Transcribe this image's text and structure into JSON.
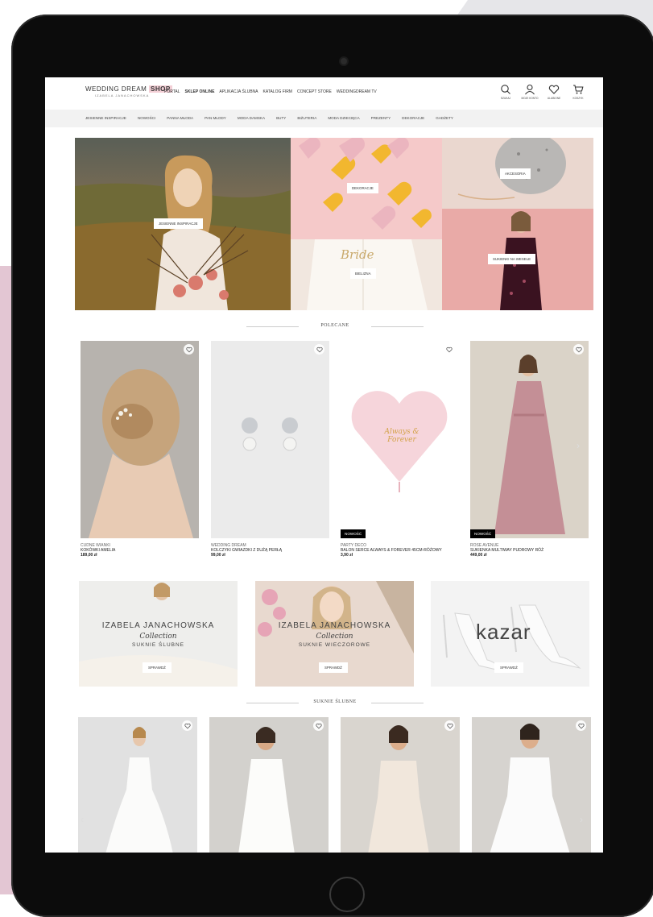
{
  "header": {
    "logo_main": "WEDDING DREAM",
    "logo_shop": "SHOP",
    "logo_sub": "IZABELA JANACHOWSKA",
    "nav": [
      "PORTAL",
      "SKLEP ONLINE",
      "APLIKACJA ŚLUBNA",
      "KATALOG FIRM",
      "CONCEPT STORE",
      "WEDDINGDREAM TV"
    ],
    "icons": [
      {
        "name": "search-icon",
        "label": "SZUKAJ"
      },
      {
        "name": "account-icon",
        "label": "MOJE KONTO"
      },
      {
        "name": "heart-icon",
        "label": "ULUBIONE"
      },
      {
        "name": "cart-icon",
        "label": "KOSZYK"
      }
    ]
  },
  "categories": [
    "JESIENNE INSPIRACJE",
    "NOWOŚCI",
    "PANNA MŁODA",
    "PAN MŁODY",
    "MODA DAMSKA",
    "BUTY",
    "BIŻUTERIA",
    "MODA DZIECIĘCA",
    "PREZENTY",
    "DEKORACJE",
    "GADŻETY"
  ],
  "hero": {
    "jesienne": "JESIENNE INSPIRACJE",
    "dekoracje": "DEKORACJE",
    "akcesoria": "AKCESORIA",
    "sukienki": "SUKIENKI NA WESELE",
    "bielizna": "BIELIZNA",
    "bride_script": "Bride"
  },
  "featured": {
    "title": "POLECANE",
    "products": [
      {
        "brand": "CUDNE WIANKI",
        "name": "KOKÓWKI AMELIA",
        "price": "189,00 zł",
        "badge": ""
      },
      {
        "brand": "WEDDING DREAM",
        "name": "KOLCZYKI GWIAZDKI Z DUŻĄ PERŁĄ",
        "price": "99,00 zł",
        "badge": ""
      },
      {
        "brand": "PARTY DECO",
        "name": "BALON SERCE ALWAYS & FOREVER 45CM-RÓŻOWY",
        "price": "3,90 zł",
        "badge": "NOWOŚĆ"
      },
      {
        "brand": "ROSE AVENUE",
        "name": "SUKIENKA MULTIWAY PUDROWY RÓŻ",
        "price": "449,00 zł",
        "badge": "NOWOŚĆ"
      }
    ],
    "balloon_script": "Always & Forever"
  },
  "banners": [
    {
      "title": "IZABELA JANACHOWSKA",
      "script": "Collection",
      "sub": "SUKNIE ŚLUBNE",
      "button": "SPRAWDŹ"
    },
    {
      "title": "IZABELA JANACHOWSKA",
      "script": "Collection",
      "sub": "SUKNIE WIECZOROWE",
      "button": "SPRAWDŹ"
    },
    {
      "brand": "kazar",
      "button": "SPRAWDŹ"
    }
  ],
  "wedding_dresses": {
    "title": "SUKNIE ŚLUBNE"
  },
  "colors": {
    "accent_pink": "#f3cfd6",
    "badge_black": "#000000",
    "background": "#ffffff"
  }
}
